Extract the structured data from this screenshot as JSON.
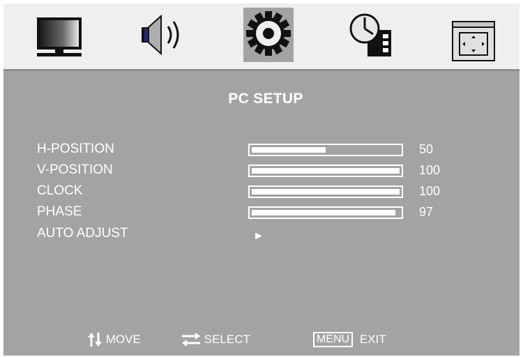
{
  "menu": {
    "tabs": [
      {
        "name": "picture",
        "icon": "monitor-icon",
        "active": false
      },
      {
        "name": "sound",
        "icon": "speaker-icon",
        "active": false
      },
      {
        "name": "setup",
        "icon": "gear-icon",
        "active": true
      },
      {
        "name": "time",
        "icon": "clock-icon",
        "active": false
      },
      {
        "name": "option",
        "icon": "screen-adjust-icon",
        "active": false
      }
    ]
  },
  "panel": {
    "title": "PC SETUP",
    "items": [
      {
        "label": "H-POSITION",
        "value": "50",
        "level": 0.5
      },
      {
        "label": "V-POSITION",
        "value": "100",
        "level": 1.0
      },
      {
        "label": "CLOCK",
        "value": "100",
        "level": 1.0
      },
      {
        "label": "PHASE",
        "value": "97",
        "level": 0.97
      },
      {
        "label": "AUTO ADJUST",
        "action_icon": "play-arrow-icon"
      }
    ]
  },
  "footer": {
    "move_label": "MOVE",
    "select_label": "SELECT",
    "menu_key": "MENU",
    "exit_label": "EXIT"
  },
  "colors": {
    "panel_bg": "#a3a3a3",
    "tabbar_bg": "#efefef",
    "text": "#ffffff"
  }
}
